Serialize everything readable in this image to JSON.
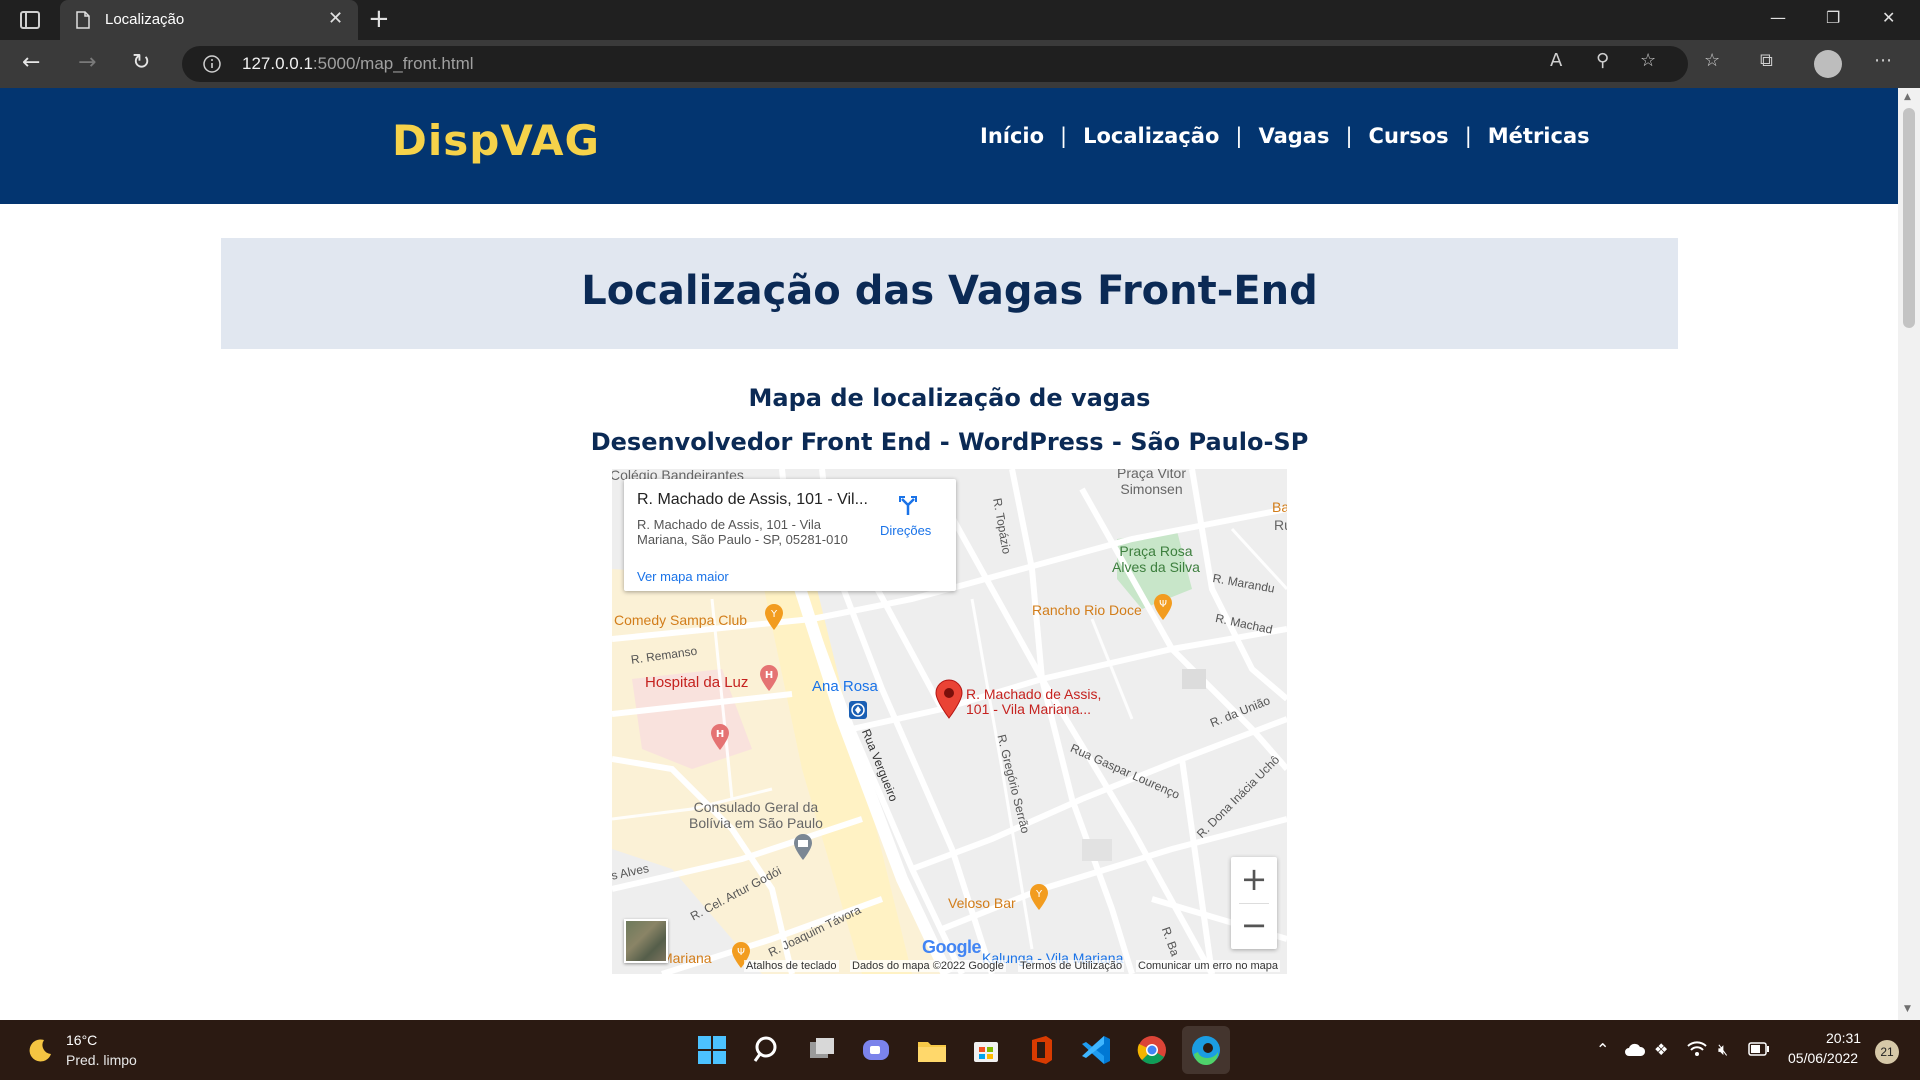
{
  "browser": {
    "tab_title": "Localização",
    "url_host": "127.0.0.1",
    "url_rest": ":5000/map_front.html"
  },
  "site": {
    "logo": "DispVAG",
    "menu": [
      "Início",
      "Localização",
      "Vagas",
      "Cursos",
      "Métricas"
    ],
    "separator": "|"
  },
  "page": {
    "heading": "Localização das Vagas Front-End",
    "subtitle1": "Mapa de localização de vagas",
    "subtitle2": "Desenvolvedor Front End - WordPress - São Paulo-SP"
  },
  "map": {
    "card_title": "R. Machado de Assis, 101 - Vil...",
    "card_address_line1": "R. Machado de Assis, 101 - Vila",
    "card_address_line2": "Mariana, São Paulo - SP, 05281-010",
    "card_link": "Ver mapa maior",
    "card_directions": "Direções",
    "marker_label_line1": "R. Machado de Assis,",
    "marker_label_line2": "101 - Vila Mariana...",
    "places": {
      "colegio": "Colégio Bandeirantes",
      "praca_vitor_1": "Praça Vitor",
      "praca_vitor_2": "Simonsen",
      "praca_rosa_1": "Praça Rosa",
      "praca_rosa_2": "Alves da Silva",
      "rancho": "Rancho Rio Doce",
      "comedy": "Comedy Sampa Club",
      "hospital": "Hospital da Luz",
      "ana_rosa": "Ana Rosa",
      "consulado_1": "Consulado Geral da",
      "consulado_2": "Bolívia em São Paulo",
      "veloso": "Veloso Bar",
      "kalunga": "Kalunga - Vila Mariana",
      "vila_mariana": "Vila Mariana",
      "bar": "Bar e",
      "rua": "Rua"
    },
    "streets": {
      "topazio": "R. Topázio",
      "marandu": "R. Marandu",
      "machado": "R. Machad",
      "remanso": "R. Remanso",
      "vergueiro": "Rua Vergueiro",
      "gregorio": "R. Gregório Serrão",
      "gaspar": "Rua Gaspar Lourenço",
      "uniao": "R. da União",
      "dona_inacia": "R. Dona Inácia Uchô",
      "alves": "s Alves",
      "artur": "R. Cel. Artur Godói",
      "joaquim": "R. Joaquim Távora",
      "rba": "R. Ba"
    },
    "zoom_in": "+",
    "zoom_out": "−",
    "google": "Google",
    "attrib": [
      "Atalhos de teclado",
      "Dados do mapa ©2022 Google",
      "Termos de Utilização",
      "Comunicar um erro no mapa"
    ]
  },
  "taskbar": {
    "temp": "16°C",
    "weather": "Pred. limpo",
    "time": "20:31",
    "date": "05/06/2022",
    "notifications": "21"
  },
  "colors": {
    "header_bg": "#033570",
    "logo": "#f6d24a",
    "heading": "#0b2a55",
    "hero_bg": "#e1e7f0"
  }
}
